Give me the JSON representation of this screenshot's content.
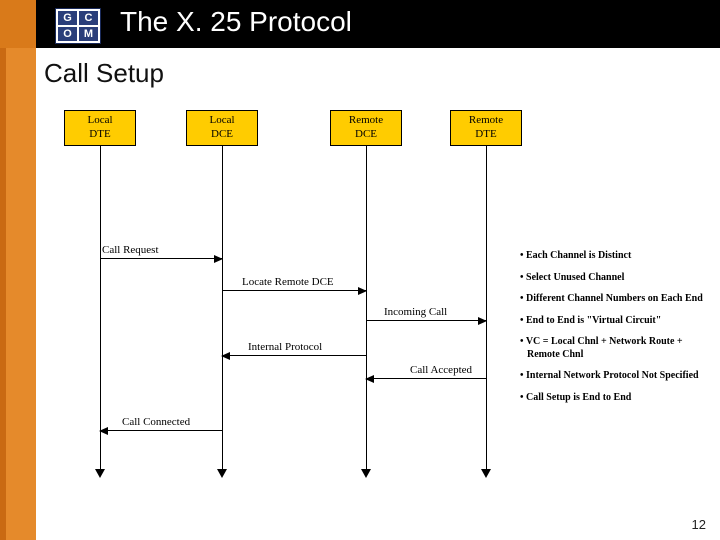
{
  "logo": {
    "c1": "G",
    "c2": "C",
    "c3": "O",
    "c4": "M"
  },
  "title": "The X. 25 Protocol",
  "subtitle": "Call Setup",
  "lifelines": {
    "localDTE": {
      "l1": "Local",
      "l2": "DTE"
    },
    "localDCE": {
      "l1": "Local",
      "l2": "DCE"
    },
    "remoteDCE": {
      "l1": "Remote",
      "l2": "DCE"
    },
    "remoteDTE": {
      "l1": "Remote",
      "l2": "DTE"
    }
  },
  "messages": {
    "callRequest": "Call Request",
    "locateRemoteDCE": "Locate Remote DCE",
    "incomingCall": "Incoming Call",
    "internalProtocol": "Internal Protocol",
    "callAccepted": "Call Accepted",
    "callConnected": "Call Connected"
  },
  "notes": {
    "n1": "• Each Channel is Distinct",
    "n2": "• Select Unused Channel",
    "n3": "• Different Channel Numbers on Each End",
    "n4": "• End to End is \"Virtual Circuit\"",
    "n5": "• VC = Local Chnl + Network Route + Remote Chnl",
    "n6": "• Internal Network Protocol Not Specified",
    "n7": "• Call Setup is End to End"
  },
  "pageNumber": "12"
}
